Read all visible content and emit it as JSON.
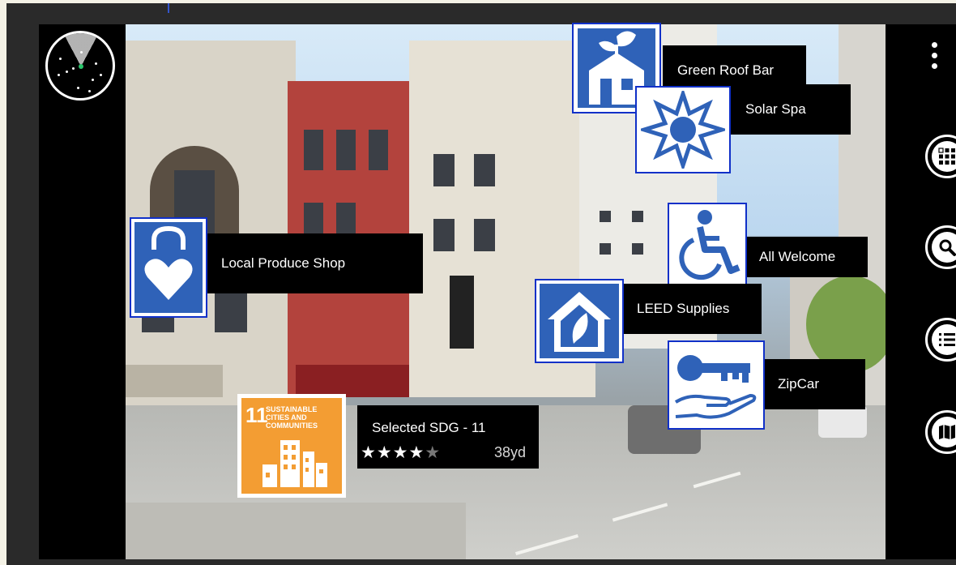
{
  "menu": {
    "more_icon": "more-vertical-icon"
  },
  "controls": [
    {
      "name": "grid-button",
      "icon": "grid-icon"
    },
    {
      "name": "search-button",
      "icon": "search-icon"
    },
    {
      "name": "list-button",
      "icon": "list-icon"
    },
    {
      "name": "map-button",
      "icon": "map-icon"
    }
  ],
  "radar": {
    "icon": "radar-icon"
  },
  "pois": {
    "green_roof_bar": {
      "label": "Green Roof Bar",
      "icon": "house-sprout-icon"
    },
    "solar_spa": {
      "label": "Solar Spa",
      "icon": "sun-icon"
    },
    "local_produce_shop": {
      "label": "Local Produce Shop",
      "icon": "bag-heart-icon"
    },
    "all_welcome": {
      "label": "All Welcome",
      "icon": "wheelchair-icon"
    },
    "leed_supplies": {
      "label": "LEED Supplies",
      "icon": "house-leaf-icon"
    },
    "zipcar": {
      "label": "ZipCar",
      "icon": "key-hand-icon"
    }
  },
  "selected": {
    "sdg_number": "11",
    "sdg_title": "SUSTAINABLE CITIES AND COMMUNITIES",
    "caption": "Selected SDG - 11",
    "rating": 4,
    "rating_max": 5,
    "stars_full": "★★★★",
    "stars_empty": "★",
    "distance": "38yd"
  },
  "colors": {
    "poi_blue": "#2f62b8",
    "border_blue": "#1030c8",
    "sdg_orange": "#f39d33"
  }
}
